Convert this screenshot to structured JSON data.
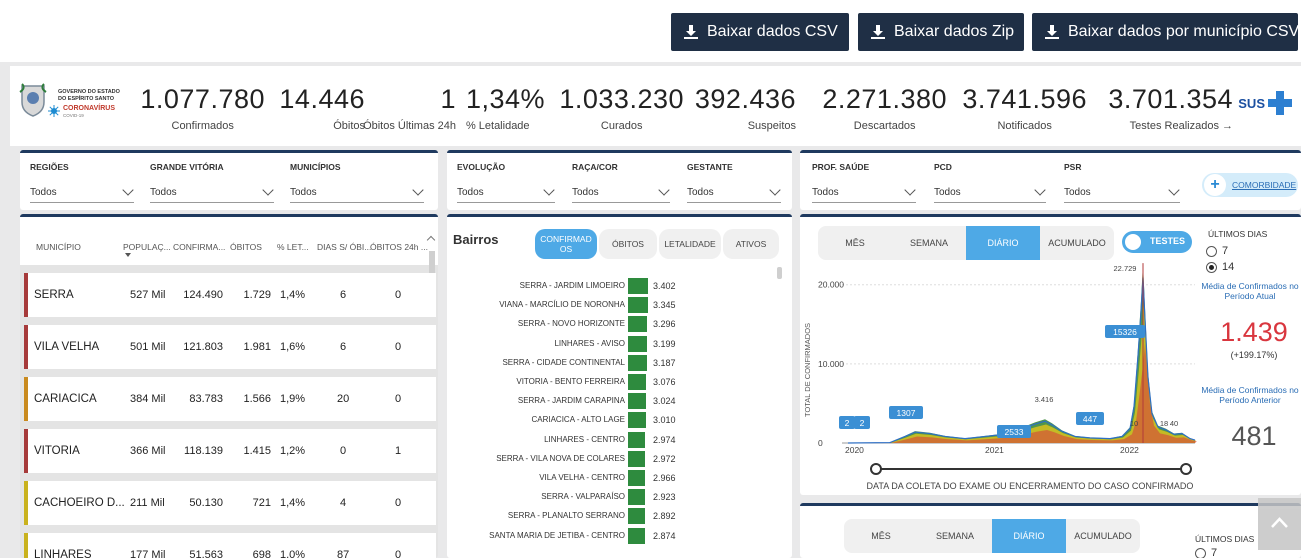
{
  "downloads": [
    {
      "label": "Baixar dados CSV"
    },
    {
      "label": "Baixar dados Zip"
    },
    {
      "label": "Baixar dados por município CSV"
    }
  ],
  "logo": {
    "line1": "GOVERNO DO ESTADO",
    "line2": "DO ESPÍRITO SANTO",
    "brand": "CORONAVÍRUS",
    "brand_sub": "COVID-19"
  },
  "stats": [
    {
      "value": "1.077.780",
      "label": "Confirmados"
    },
    {
      "value": "14.446",
      "label": "Óbitos"
    },
    {
      "value": "1",
      "label": "Óbitos Últimas 24h"
    },
    {
      "value": "1,34%",
      "label": "% Letalidade"
    },
    {
      "value": "1.033.230",
      "label": "Curados"
    },
    {
      "value": "392.436",
      "label": "Suspeitos"
    },
    {
      "value": "2.271.380",
      "label": "Descartados"
    },
    {
      "value": "3.741.596",
      "label": "Notificados"
    },
    {
      "value": "3.701.354",
      "label": "Testes Realizados →"
    }
  ],
  "sus_label": "SUS",
  "filters1": [
    {
      "label": "REGIÕES",
      "value": "Todos"
    },
    {
      "label": "GRANDE VITÓRIA",
      "value": "Todos"
    },
    {
      "label": "MUNICÍPIOS",
      "value": "Todos"
    }
  ],
  "filters2": [
    {
      "label": "EVOLUÇÃO",
      "value": "Todos"
    },
    {
      "label": "RAÇA/COR",
      "value": "Todos"
    },
    {
      "label": "GESTANTE",
      "value": "Todos"
    }
  ],
  "filters3": [
    {
      "label": "PROF. SAÚDE",
      "value": "Todos"
    },
    {
      "label": "PCD",
      "value": "Todos"
    },
    {
      "label": "PSR",
      "value": "Todos"
    }
  ],
  "comorbidade_label": "COMORBIDADE",
  "table": {
    "headers": [
      "MUNICÍPIO",
      "POPULAÇ...",
      "CONFIRMA...",
      "ÓBITOS",
      "% LET...",
      "DIAS S/ ÓBI...",
      "ÓBITOS 24h ..."
    ],
    "rows": [
      {
        "name": "SERRA",
        "pop": "527 Mil",
        "conf": "124.490",
        "obitos": "1.729",
        "let": "1,4%",
        "dias": "6",
        "ob24": "0",
        "color": "#a63a3a"
      },
      {
        "name": "VILA VELHA",
        "pop": "501 Mil",
        "conf": "121.803",
        "obitos": "1.981",
        "let": "1,6%",
        "dias": "6",
        "ob24": "0",
        "color": "#a63a3a"
      },
      {
        "name": "CARIACICA",
        "pop": "384 Mil",
        "conf": "83.783",
        "obitos": "1.566",
        "let": "1,9%",
        "dias": "20",
        "ob24": "0",
        "color": "#c98a1e"
      },
      {
        "name": "VITORIA",
        "pop": "366 Mil",
        "conf": "118.139",
        "obitos": "1.415",
        "let": "1,2%",
        "dias": "0",
        "ob24": "1",
        "color": "#a63a3a"
      },
      {
        "name": "CACHOEIRO D...",
        "pop": "211 Mil",
        "conf": "50.130",
        "obitos": "721",
        "let": "1,4%",
        "dias": "4",
        "ob24": "0",
        "color": "#c9b21e"
      },
      {
        "name": "LINHARES",
        "pop": "177 Mil",
        "conf": "51.563",
        "obitos": "698",
        "let": "1,0%",
        "dias": "87",
        "ob24": "0",
        "color": "#c9b21e"
      }
    ]
  },
  "bairros": {
    "title": "Bairros",
    "tabs": [
      "CONFIRMAD OS",
      "ÓBITOS",
      "LETALIDADE",
      "ATIVOS"
    ],
    "items": [
      {
        "name": "SERRA - JARDIM LIMOEIRO",
        "value": "3.402",
        "num": 3402
      },
      {
        "name": "VIANA - MARCÍLIO DE NORONHA",
        "value": "3.345",
        "num": 3345
      },
      {
        "name": "SERRA - NOVO HORIZONTE",
        "value": "3.296",
        "num": 3296
      },
      {
        "name": "LINHARES - AVISO",
        "value": "3.199",
        "num": 3199
      },
      {
        "name": "SERRA - CIDADE CONTINENTAL",
        "value": "3.187",
        "num": 3187
      },
      {
        "name": "VITORIA - BENTO FERREIRA",
        "value": "3.076",
        "num": 3076
      },
      {
        "name": "SERRA - JARDIM CARAPINA",
        "value": "3.024",
        "num": 3024
      },
      {
        "name": "CARIACICA - ALTO LAGE",
        "value": "3.010",
        "num": 3010
      },
      {
        "name": "LINHARES - CENTRO",
        "value": "2.974",
        "num": 2974
      },
      {
        "name": "SERRA - VILA NOVA DE COLARES",
        "value": "2.972",
        "num": 2972
      },
      {
        "name": "VILA VELHA - CENTRO",
        "value": "2.966",
        "num": 2966
      },
      {
        "name": "SERRA - VALPARAÍSO",
        "value": "2.923",
        "num": 2923
      },
      {
        "name": "SERRA - PLANALTO SERRANO",
        "value": "2.892",
        "num": 2892
      },
      {
        "name": "SANTA MARIA DE JETIBA - CENTRO",
        "value": "2.874",
        "num": 2874
      }
    ]
  },
  "chart_panel": {
    "tabs": [
      "MÊS",
      "SEMANA",
      "DIÁRIO",
      "ACUMULADO"
    ],
    "toggle_label": "TESTES",
    "ultimos_label": "ÚLTIMOS DIAS",
    "options": [
      "7",
      "14"
    ],
    "media_atual_label": "Média de Confirmados no Período Atual",
    "media_atual": "1.439",
    "media_atual_pct": "(+199.17%)",
    "media_anterior_label": "Média de Confirmados no Período Anterior",
    "media_anterior": "481",
    "xaxis_label": "DATA DA COLETA DO EXAME OU ENCERRAMENTO DO CASO CONFIRMADO",
    "yaxis_label": "TOTAL DE CONFIRMADOS"
  },
  "chart_data": {
    "type": "area",
    "title": "",
    "ylabel": "TOTAL DE CONFIRMADOS",
    "xlabel": "DATA DA COLETA DO EXAME OU ENCERRAMENTO DO CASO CONFIRMADO",
    "x_ticks": [
      "2020",
      "2021",
      "2022"
    ],
    "y_ticks": [
      "0",
      "10.000",
      "20.000"
    ],
    "ylim": [
      0,
      23500
    ],
    "annotations": [
      {
        "label": "2",
        "value": 2
      },
      {
        "label": "2",
        "value": 2
      },
      {
        "label": "1307",
        "value": 1307
      },
      {
        "label": "2533",
        "value": 2533
      },
      {
        "label": "3.416",
        "value": 3416
      },
      {
        "label": "447",
        "value": 447
      },
      {
        "label": "15326",
        "value": 15326
      },
      {
        "label": "22.729",
        "value": 22729
      },
      {
        "label": "10",
        "value": 10
      },
      {
        "label": "18",
        "value": 18
      },
      {
        "label": "40",
        "value": 40
      }
    ]
  },
  "bottom_panel": {
    "tabs": [
      "MÊS",
      "SEMANA",
      "DIÁRIO",
      "ACUMULADO"
    ],
    "ultimos_label": "ÚLTIMOS DIAS",
    "option": "7"
  }
}
